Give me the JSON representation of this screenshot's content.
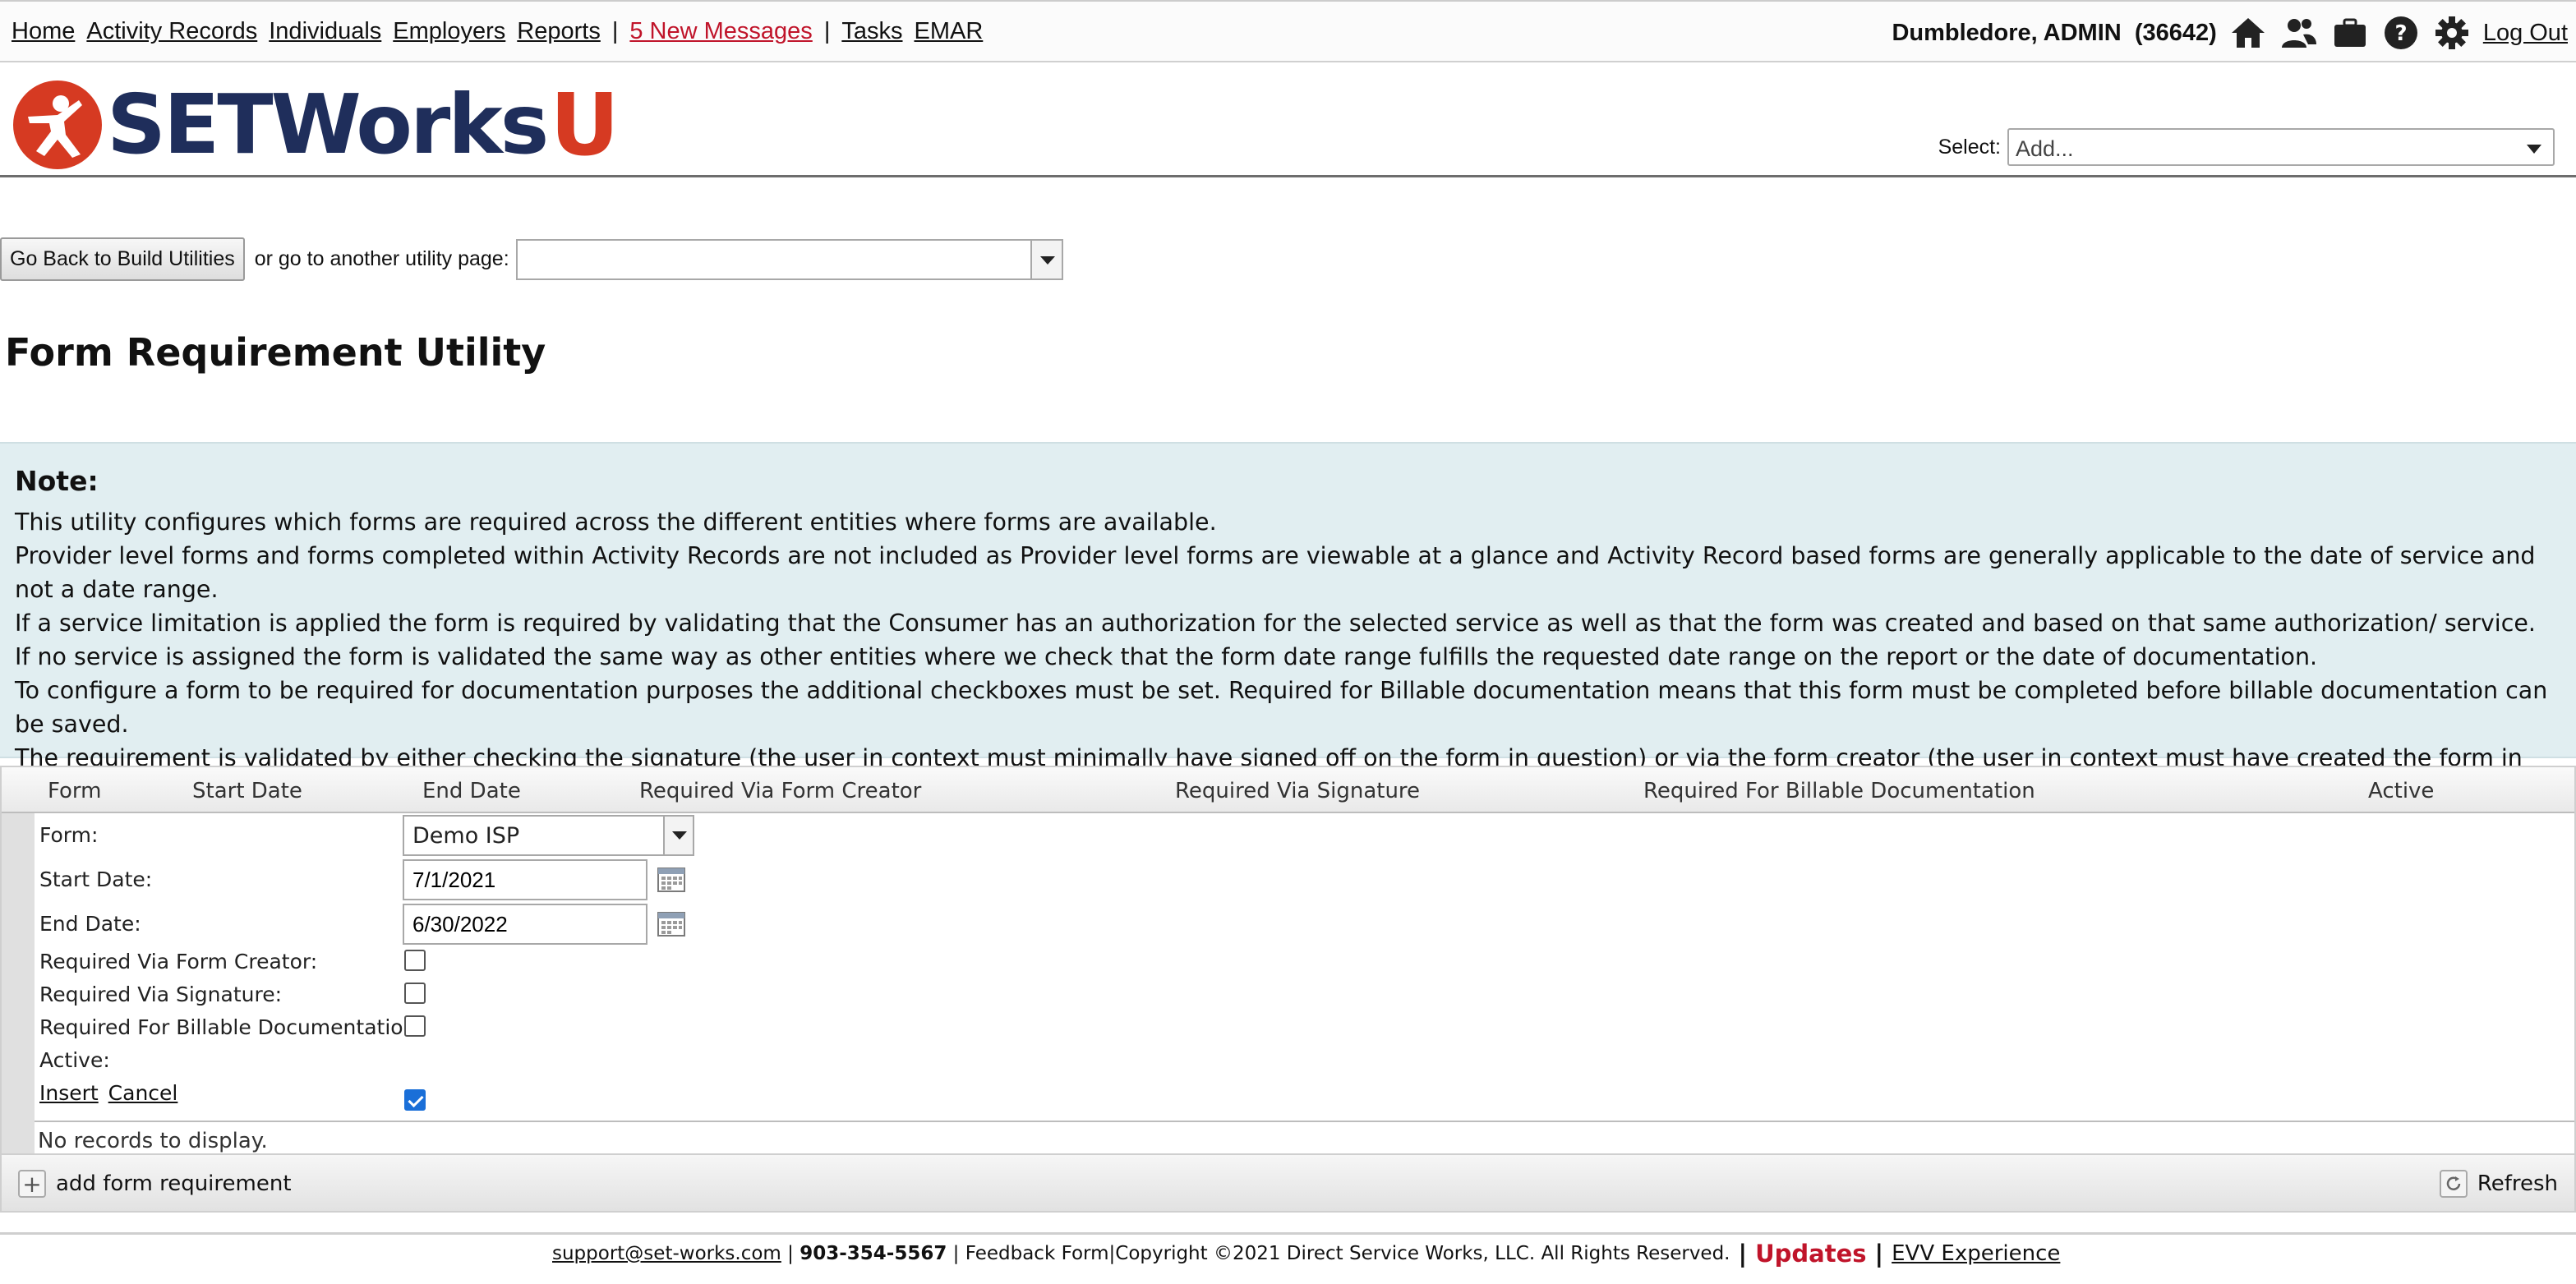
{
  "nav": {
    "home": "Home",
    "activity_records": "Activity Records",
    "individuals": "Individuals",
    "employers": "Employers",
    "reports": "Reports",
    "separator": "|",
    "messages": "5 New Messages",
    "tasks": "Tasks",
    "emar": "EMAR"
  },
  "user": {
    "name": "Dumbledore, ADMIN",
    "id": "(36642)",
    "logout": "Log Out"
  },
  "logo": {
    "word": "SETWorks",
    "letter": "U"
  },
  "header_select": {
    "label": "Select:",
    "value": "Add..."
  },
  "utility": {
    "back_button": "Go Back to Build Utilities",
    "goto_text": "or go to another utility page:",
    "goto_value": ""
  },
  "page_title": "Form Requirement Utility",
  "note": {
    "heading": "Note:",
    "lines": [
      "This utility configures which forms are required across the different entities where forms are available.",
      "Provider level forms and forms completed within Activity Records are not included as Provider level forms are viewable at a glance and Activity Record based forms are generally applicable to the date of service and not a date range.",
      "If a service limitation is applied the form is required by validating that the Consumer has an authorization for the selected service as well as that the form was created and based on that same authorization/ service.",
      "If no service is assigned the form is validated the same way as other entities where we check that the form date range fulfills the requested date range on the report or the date of documentation.",
      "To configure a form to be required for documentation purposes the additional checkboxes must be set. Required for Billable documentation means that this form must be completed before billable documentation can be saved.",
      "The requirement is validated by either checking the signature (the user in context must minimally have signed off on the form in question) or via the form creator (the user in context must have created the form in question)."
    ]
  },
  "grid": {
    "columns": [
      "Form",
      "Start Date",
      "End Date",
      "Required Via Form Creator",
      "Required Via Signature",
      "Required For Billable Documentation",
      "Active"
    ],
    "edit": {
      "form_label": "Form:",
      "form_value": "Demo ISP",
      "start_label": "Start Date:",
      "start_value": "7/1/2021",
      "end_label": "End Date:",
      "end_value": "6/30/2022",
      "creator_label": "Required Via Form Creator:",
      "creator_checked": false,
      "signature_label": "Required Via Signature:",
      "signature_checked": false,
      "billable_label": "Required For Billable Documentation:",
      "billable_checked": false,
      "active_label": "Active:",
      "active_checked": true,
      "insert": "Insert",
      "cancel": "Cancel"
    },
    "no_records": "No records to display.",
    "add_label": "add form requirement",
    "refresh_label": "Refresh"
  },
  "footer": {
    "email": "support@set-works.com",
    "sep1": "|",
    "phone": "903-354-5567",
    "sep2": "|",
    "feedback": "Feedback Form",
    "copyright": "|Copyright ©2021 Direct Service Works, LLC. All Rights Reserved.",
    "bar1": "|",
    "updates": "Updates",
    "bar2": "|",
    "evv": "EVV Experience"
  },
  "colors": {
    "accent_red": "#c0142a",
    "logo_navy": "#1f2e5b",
    "logo_red": "#d63a22",
    "note_bg": "#e1eef1"
  },
  "icons": [
    "home-icon",
    "users-icon",
    "briefcase-icon",
    "help-icon",
    "gear-icon",
    "calendar-icon",
    "plus-icon",
    "refresh-icon"
  ]
}
